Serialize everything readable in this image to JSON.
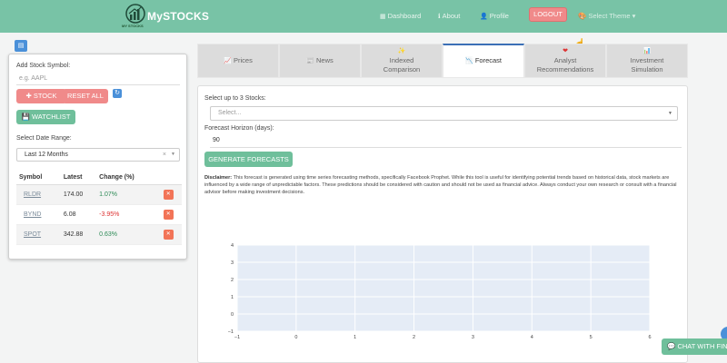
{
  "header": {
    "brand": "MySTOCKS",
    "brand_sub": "MY STOCKS",
    "nav": [
      {
        "label": "Dashboard",
        "icon": "dashboard-icon"
      },
      {
        "label": "About",
        "icon": "info-icon"
      },
      {
        "label": "Profile",
        "icon": "user-icon"
      }
    ],
    "logout": "LOGOUT",
    "theme": "Select Theme"
  },
  "sidebar": {
    "add_label": "Add Stock Symbol:",
    "symbol_placeholder": "e.g. AAPL",
    "stock_button": "STOCK",
    "reset_button": "RESET ALL",
    "watchlist_button": "WATCHLIST",
    "date_label": "Select Date Range:",
    "date_value": "Last 12 Months",
    "table": {
      "headers": [
        "Symbol",
        "Latest",
        "Change (%)"
      ],
      "rows": [
        {
          "symbol": "RLDR",
          "latest": "174.00",
          "change": "1.07%",
          "dir": "up"
        },
        {
          "symbol": "BYND",
          "latest": "6.08",
          "change": "-3.95%",
          "dir": "down"
        },
        {
          "symbol": "SPOT",
          "latest": "342.88",
          "change": "0.63%",
          "dir": "up"
        }
      ]
    }
  },
  "tabs": [
    {
      "label": "Prices",
      "icon": "chart-line-icon"
    },
    {
      "label": "News",
      "icon": "newspaper-icon"
    },
    {
      "label": "Indexed Comparison",
      "icon": "star-icon"
    },
    {
      "label": "Forecast",
      "icon": "trend-down-icon",
      "active": true
    },
    {
      "label": "Analyst Recommendations",
      "icon": "heart-icon"
    },
    {
      "label": "Investment Simulation",
      "icon": "bar-chart-icon"
    }
  ],
  "forecast": {
    "select_label": "Select up to 3 Stocks:",
    "select_placeholder": "Select...",
    "horizon_label": "Forecast Horizon (days):",
    "horizon_value": "90",
    "generate_button": "GENERATE FORECASTS",
    "disclaimer_title": "Disclaimer:",
    "disclaimer_text": "This forecast is generated using time series forecasting methods, specifically Facebook Prophet. While this tool is useful for identifying potential trends based on historical data, stock markets are influenced by a wide range of unpredictable factors. These predictions should be considered with caution and should not be used as financial advice. Always conduct your own research or consult with a financial advisor before making investment decisions."
  },
  "chart_data": {
    "type": "line",
    "series": [],
    "x_ticks": [
      "−1",
      "0",
      "1",
      "2",
      "3",
      "4",
      "5",
      "6"
    ],
    "y_ticks": [
      "4",
      "3",
      "2",
      "1",
      "0",
      "−1"
    ],
    "xlim": [
      -1,
      6
    ],
    "ylim": [
      -1,
      4
    ],
    "grid": true
  },
  "chat_button": "CHAT WITH FIN",
  "colors": {
    "header": "#78c3a6",
    "accent_green": "#6fbf9b",
    "accent_red": "#f08a8a",
    "active_tab": "#3b6fb6"
  }
}
